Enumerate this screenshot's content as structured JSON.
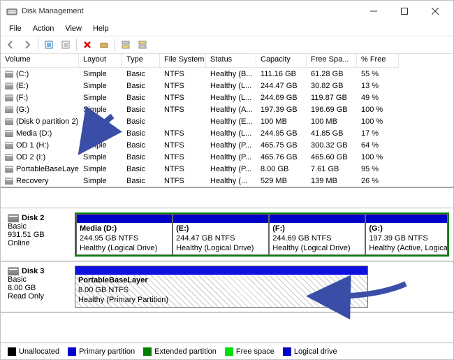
{
  "window": {
    "title": "Disk Management"
  },
  "menu": {
    "file": "File",
    "action": "Action",
    "view": "View",
    "help": "Help"
  },
  "columns": {
    "volume": "Volume",
    "layout": "Layout",
    "type": "Type",
    "fs": "File System",
    "status": "Status",
    "capacity": "Capacity",
    "free": "Free Spa...",
    "pct": "% Free"
  },
  "volumes": [
    {
      "name": "(C:)",
      "layout": "Simple",
      "type": "Basic",
      "fs": "NTFS",
      "status": "Healthy (B...",
      "capacity": "111.16 GB",
      "free": "61.28 GB",
      "pct": "55 %"
    },
    {
      "name": "(E:)",
      "layout": "Simple",
      "type": "Basic",
      "fs": "NTFS",
      "status": "Healthy (L...",
      "capacity": "244.47 GB",
      "free": "30.82 GB",
      "pct": "13 %"
    },
    {
      "name": "(F:)",
      "layout": "Simple",
      "type": "Basic",
      "fs": "NTFS",
      "status": "Healthy (L...",
      "capacity": "244.69 GB",
      "free": "119.87 GB",
      "pct": "49 %"
    },
    {
      "name": "(G:)",
      "layout": "Simple",
      "type": "Basic",
      "fs": "NTFS",
      "status": "Healthy (A...",
      "capacity": "197.39 GB",
      "free": "196.69 GB",
      "pct": "100 %"
    },
    {
      "name": "(Disk 0 partition 2)",
      "layout": "Simple",
      "type": "Basic",
      "fs": "",
      "status": "Healthy (E...",
      "capacity": "100 MB",
      "free": "100 MB",
      "pct": "100 %"
    },
    {
      "name": "Media (D:)",
      "layout": "Simple",
      "type": "Basic",
      "fs": "NTFS",
      "status": "Healthy (L...",
      "capacity": "244.95 GB",
      "free": "41.85 GB",
      "pct": "17 %"
    },
    {
      "name": "OD 1 (H:)",
      "layout": "Simple",
      "type": "Basic",
      "fs": "NTFS",
      "status": "Healthy (P...",
      "capacity": "465.75 GB",
      "free": "300.32 GB",
      "pct": "64 %"
    },
    {
      "name": "OD 2 (I:)",
      "layout": "Simple",
      "type": "Basic",
      "fs": "NTFS",
      "status": "Healthy (P...",
      "capacity": "465.76 GB",
      "free": "465.60 GB",
      "pct": "100 %"
    },
    {
      "name": "PortableBaseLayer",
      "layout": "Simple",
      "type": "Basic",
      "fs": "NTFS",
      "status": "Healthy (P...",
      "capacity": "8.00 GB",
      "free": "7.61 GB",
      "pct": "95 %"
    },
    {
      "name": "Recovery",
      "layout": "Simple",
      "type": "Basic",
      "fs": "NTFS",
      "status": "Healthy (...",
      "capacity": "529 MB",
      "free": "139 MB",
      "pct": "26 %"
    }
  ],
  "disks": {
    "d2": {
      "title": "Disk 2",
      "type": "Basic",
      "size": "931.51 GB",
      "status": "Online",
      "parts": [
        {
          "name": "Media  (D:)",
          "sub": "244.95 GB NTFS",
          "health": "Healthy (Logical Drive)"
        },
        {
          "name": "(E:)",
          "sub": "244.47 GB NTFS",
          "health": "Healthy (Logical Drive)"
        },
        {
          "name": "(F:)",
          "sub": "244.69 GB NTFS",
          "health": "Healthy (Logical Drive)"
        },
        {
          "name": "(G:)",
          "sub": "197.39 GB NTFS",
          "health": "Healthy (Active, Logical D"
        }
      ]
    },
    "d3": {
      "title": "Disk 3",
      "type": "Basic",
      "size": "8.00 GB",
      "status": "Read Only",
      "part": {
        "name": "PortableBaseLayer",
        "sub": "8.00 GB NTFS",
        "health": "Healthy (Primary Partition)"
      }
    }
  },
  "legend": {
    "unalloc": "Unallocated",
    "primary": "Primary partition",
    "ext": "Extended partition",
    "free": "Free space",
    "logical": "Logical drive"
  },
  "colors": {
    "black": "#000000",
    "blue": "#0000c8",
    "green": "#008000",
    "lime": "#00e000"
  }
}
